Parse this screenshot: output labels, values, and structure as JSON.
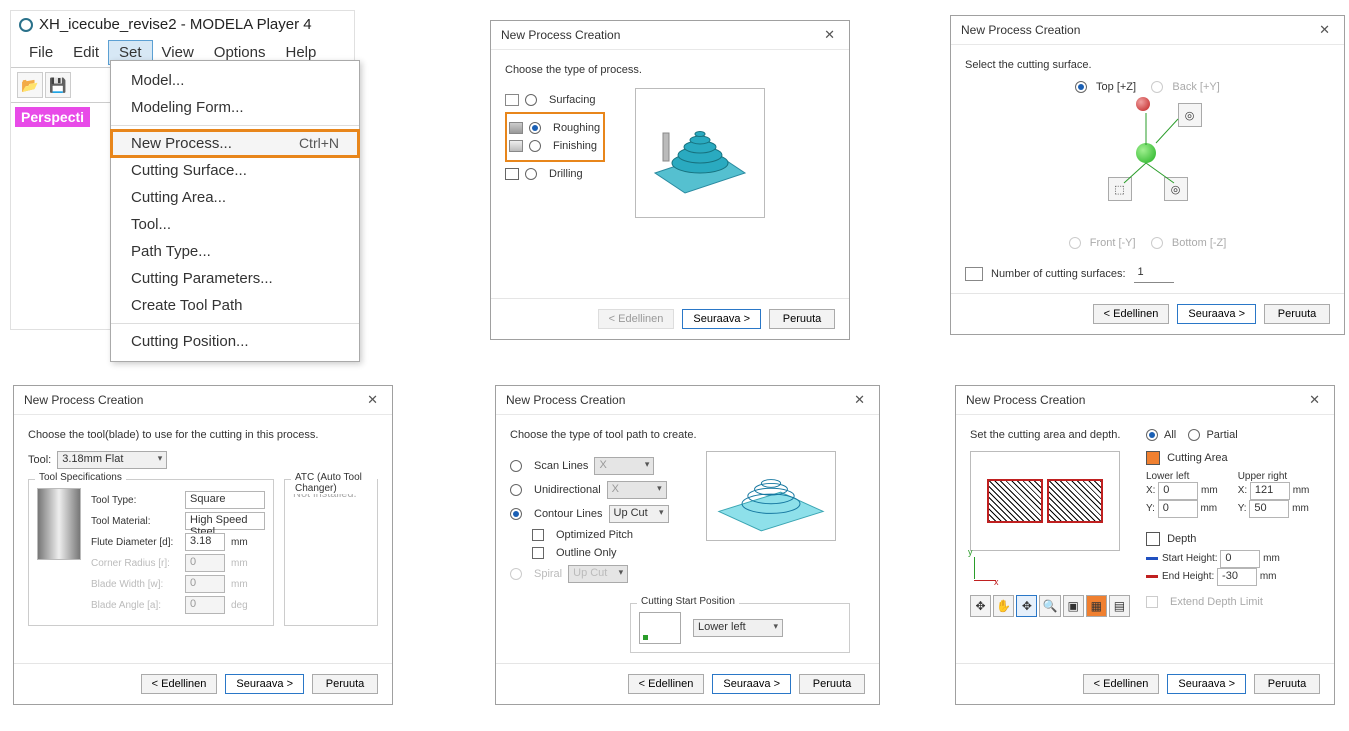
{
  "app": {
    "title": "XH_icecube_revise2 - MODELA Player 4",
    "menubar": [
      "File",
      "Edit",
      "Set",
      "View",
      "Options",
      "Help"
    ],
    "open_menu_index": 2,
    "perspective_label": "Perspecti",
    "menu": {
      "items": [
        {
          "label": "Model...",
          "shortcut": ""
        },
        {
          "label": "Modeling Form...",
          "shortcut": ""
        },
        {
          "label": "New Process...",
          "shortcut": "Ctrl+N",
          "highlight": true
        },
        {
          "label": "Cutting Surface...",
          "shortcut": ""
        },
        {
          "label": "Cutting Area...",
          "shortcut": ""
        },
        {
          "label": "Tool...",
          "shortcut": ""
        },
        {
          "label": "Path Type...",
          "shortcut": ""
        },
        {
          "label": "Cutting Parameters...",
          "shortcut": ""
        },
        {
          "label": "Create Tool Path",
          "shortcut": ""
        },
        {
          "label": "Cutting Position...",
          "shortcut": ""
        }
      ],
      "separators_before": [
        2,
        9
      ]
    }
  },
  "dialog_common": {
    "title": "New Process Creation",
    "back": "< Edellinen",
    "next": "Seuraava >",
    "cancel": "Peruuta"
  },
  "p2": {
    "prompt": "Choose the type of process.",
    "options": {
      "surfacing": "Surfacing",
      "roughing": "Roughing",
      "finishing": "Finishing",
      "drilling": "Drilling"
    },
    "selected": "roughing"
  },
  "p3": {
    "prompt": "Select the cutting surface.",
    "top": "Top [+Z]",
    "back": "Back [+Y]",
    "front": "Front [-Y]",
    "bottom": "Bottom [-Z]",
    "count_label": "Number of cutting surfaces:",
    "count_value": "1"
  },
  "p4": {
    "prompt": "Choose the tool(blade) to use for the cutting in this process.",
    "tool_label": "Tool:",
    "tool_value": "3.18mm Flat",
    "spec_title": "Tool Specifications",
    "atc_title": "ATC (Auto Tool Changer)",
    "atc_status": "Not installed.",
    "specs": {
      "tool_type": {
        "label": "Tool Type:",
        "value": "Square"
      },
      "tool_material": {
        "label": "Tool Material:",
        "value": "High Speed Steel"
      },
      "flute_dia": {
        "label": "Flute Diameter [d]:",
        "value": "3.18",
        "unit": "mm"
      },
      "corner_rad": {
        "label": "Corner Radius [r]:",
        "value": "0",
        "unit": "mm",
        "disabled": true
      },
      "blade_w": {
        "label": "Blade Width [w]:",
        "value": "0",
        "unit": "mm",
        "disabled": true
      },
      "blade_a": {
        "label": "Blade Angle [a]:",
        "value": "0",
        "unit": "deg",
        "disabled": true
      }
    }
  },
  "p5": {
    "prompt": "Choose the type of tool path to create.",
    "scan": "Scan Lines",
    "uni": "Unidirectional",
    "contour": "Contour Lines",
    "upcut": "Up Cut",
    "x_label": "X",
    "optpitch": "Optimized Pitch",
    "outline": "Outline Only",
    "spiral": "Spiral",
    "csp_title": "Cutting Start Position",
    "csp_value": "Lower left"
  },
  "p6": {
    "prompt": "Set the cutting area and depth.",
    "all": "All",
    "partial": "Partial",
    "cutting_area": "Cutting Area",
    "lower_left": "Lower left",
    "upper_right": "Upper right",
    "x": "X:",
    "y": "Y:",
    "mm": "mm",
    "ll": {
      "x": "0",
      "y": "0"
    },
    "ur": {
      "x": "121",
      "y": "50"
    },
    "depth": "Depth",
    "start_h": "Start Height:",
    "end_h": "End Height:",
    "start_val": "0",
    "end_val": "-30",
    "extend": "Extend Depth Limit",
    "axis_y": "y",
    "axis_x": "x"
  }
}
